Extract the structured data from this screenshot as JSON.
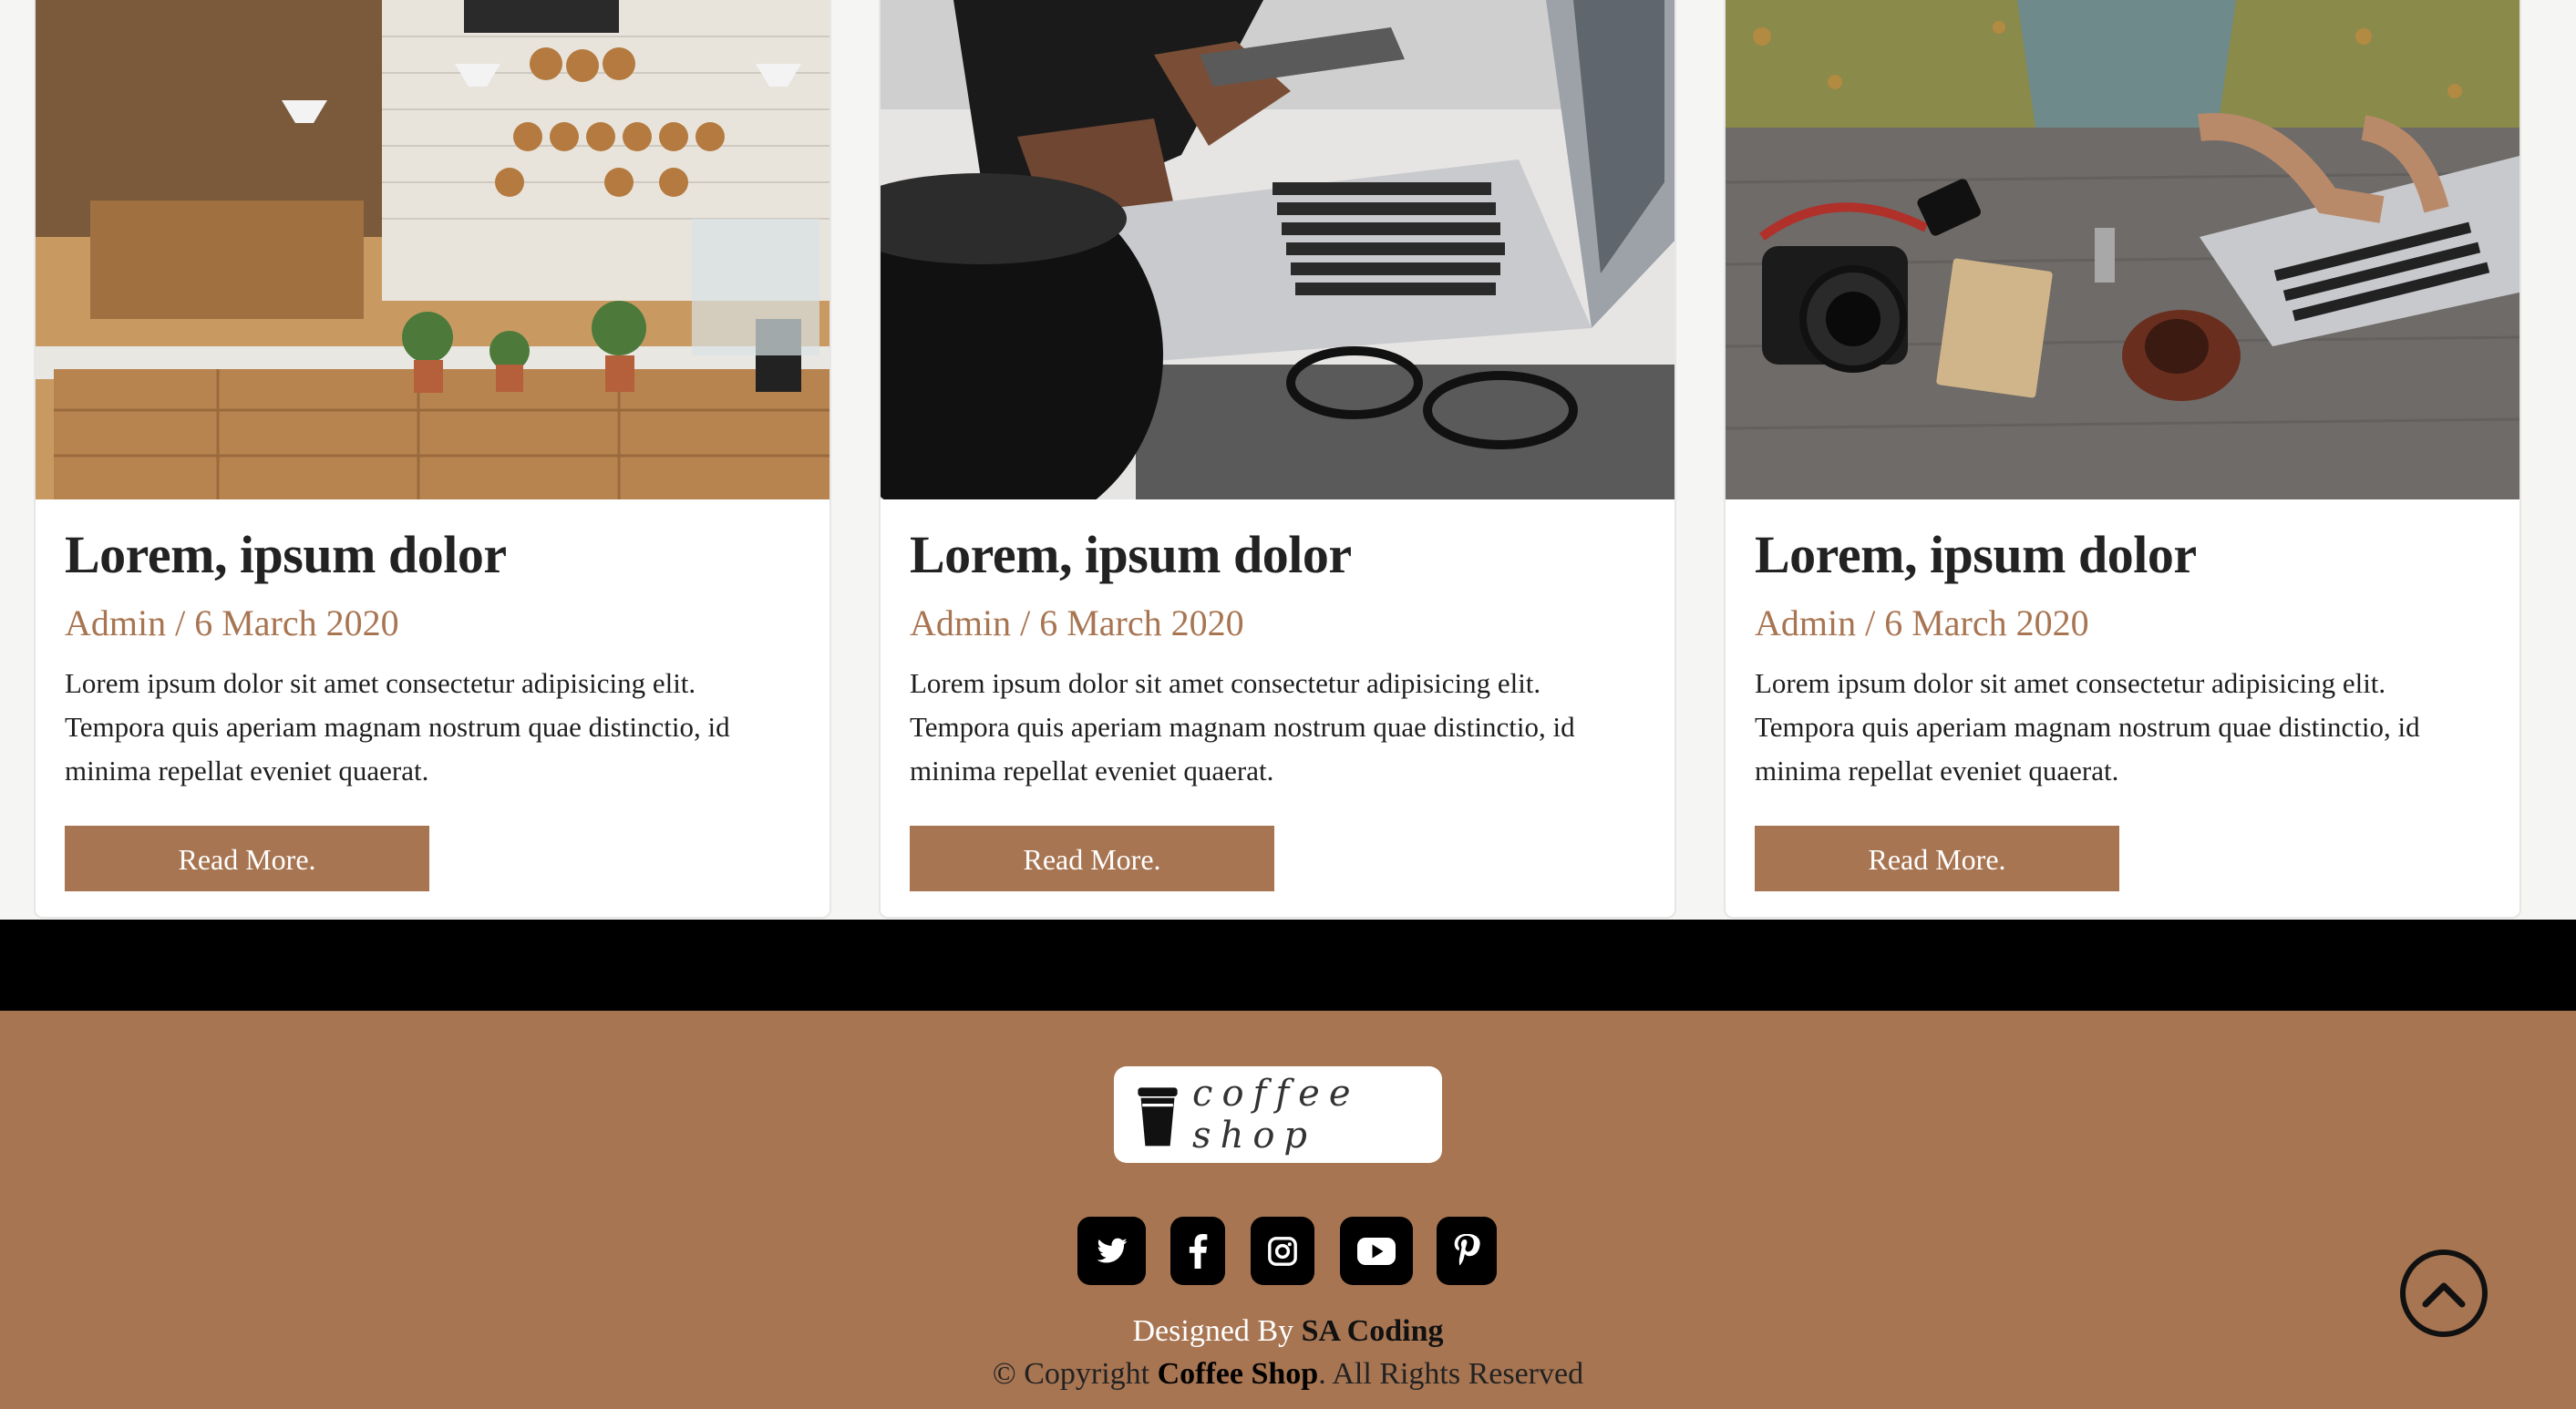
{
  "cards": [
    {
      "image_desc": "cafe-counter-photo",
      "title": "Lorem, ipsum dolor",
      "meta": "Admin / 6 March 2020",
      "text": "Lorem ipsum dolor sit amet consectetur adipisicing elit. Tempora quis aperiam magnam nostrum quae distinctio, id minima repellat eveniet quaerat.",
      "button": "Read More."
    },
    {
      "image_desc": "laptop-and-phone-photo",
      "title": "Lorem, ipsum dolor",
      "meta": "Admin / 6 March 2020",
      "text": "Lorem ipsum dolor sit amet consectetur adipisicing elit. Tempora quis aperiam magnam nostrum quae distinctio, id minima repellat eveniet quaerat.",
      "button": "Read More."
    },
    {
      "image_desc": "desk-with-camera-photo",
      "title": "Lorem, ipsum dolor",
      "meta": "Admin / 6 March 2020",
      "text": "Lorem ipsum dolor sit amet consectetur adipisicing elit. Tempora quis aperiam magnam nostrum quae distinctio, id minima repellat eveniet quaerat.",
      "button": "Read More."
    }
  ],
  "footer": {
    "logo_text": "coffee shop",
    "socials": [
      "twitter-icon",
      "facebook-icon",
      "instagram-icon",
      "youtube-icon",
      "pinterest-icon"
    ],
    "designed_prefix": "Designed By ",
    "designed_by": "SA Coding",
    "copyright_prefix": "© Copyright ",
    "copyright_brand": "Coffee Shop",
    "copyright_suffix": ". All Rights Reserved"
  },
  "colors": {
    "accent": "#a87552",
    "footer_bg": "#a87552",
    "bar": "#000000"
  }
}
